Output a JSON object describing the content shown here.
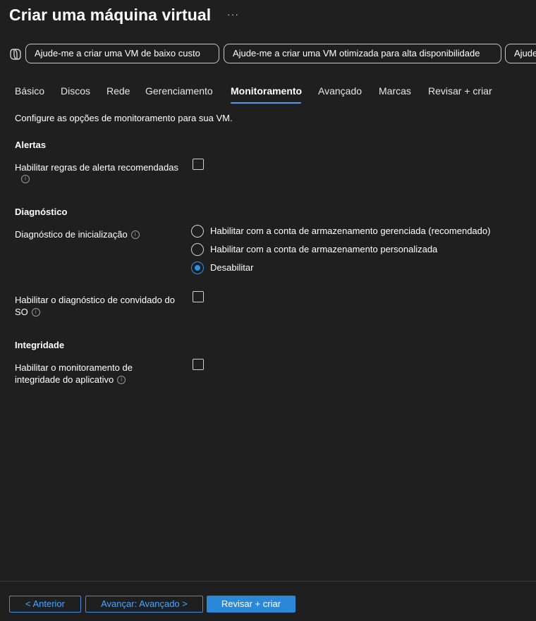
{
  "header": {
    "title": "Criar uma máquina virtual",
    "more": "···"
  },
  "copilot": {
    "icon": "copilot-icon",
    "chips": [
      "Ajude-me a criar uma VM de baixo custo",
      "Ajude-me a criar uma VM otimizada para alta disponibilidade",
      "Ajude"
    ]
  },
  "tabs": [
    {
      "label": "Básico",
      "active": false
    },
    {
      "label": "Discos",
      "active": false
    },
    {
      "label": "Rede",
      "active": false
    },
    {
      "label": "Gerenciamento",
      "active": false
    },
    {
      "label": "Monitoramento",
      "active": true
    },
    {
      "label": "Avançado",
      "active": false
    },
    {
      "label": "Marcas",
      "active": false
    },
    {
      "label": "Revisar + criar",
      "active": false
    }
  ],
  "intro": "Configure as opções de monitoramento para sua VM.",
  "alerts": {
    "heading": "Alertas",
    "recommended_rules_label": "Habilitar regras de alerta recomendadas",
    "recommended_rules_checked": false
  },
  "diagnostics": {
    "heading": "Diagnóstico",
    "boot_label": "Diagnóstico de inicialização",
    "boot_options": [
      {
        "label": "Habilitar com a conta de armazenamento gerenciada (recomendado)",
        "selected": false
      },
      {
        "label": "Habilitar com a conta de armazenamento personalizada",
        "selected": false
      },
      {
        "label": "Desabilitar",
        "selected": true
      }
    ],
    "guest_os_label_line1": "Habilitar o diagnóstico de convidado do",
    "guest_os_label_line2": "SO",
    "guest_os_checked": false
  },
  "health": {
    "heading": "Integridade",
    "app_health_label_line1": "Habilitar o monitoramento de",
    "app_health_label_line2": "integridade do aplicativo",
    "app_health_checked": false
  },
  "info_glyph": "i",
  "footer": {
    "previous": "< Anterior",
    "next": "Avançar: Avançado >",
    "review": "Revisar + criar"
  },
  "colors": {
    "background": "#1f1f1f",
    "accent": "#2b88d8",
    "tab_underline": "#4aa0f0"
  }
}
